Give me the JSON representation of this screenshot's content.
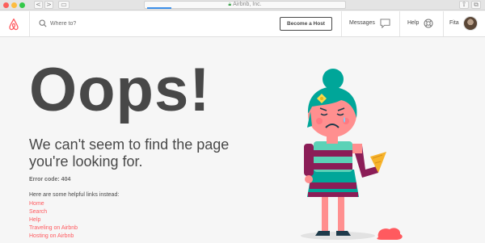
{
  "browser": {
    "url_title": "Airbnb, Inc.",
    "back": "<",
    "forward": ">"
  },
  "nav": {
    "search_placeholder": "Where to?",
    "become_host": "Become a Host",
    "messages": "Messages",
    "help": "Help",
    "user_name": "Fita"
  },
  "main": {
    "headline": "Oops!",
    "lead": "We can't seem to find the page you're looking for.",
    "error_code": "Error code: 404",
    "helpful_intro": "Here are some helpful links instead:",
    "links": [
      "Home",
      "Search",
      "Help",
      "Traveling on Airbnb",
      "Hosting on Airbnb"
    ]
  },
  "colors": {
    "brand": "#ff5a5f",
    "text": "#484848",
    "background": "#f6f6f6"
  },
  "icons": {
    "logo": "airbnb-belo-logo",
    "search": "search-icon",
    "messages": "chat-bubble-icon",
    "help": "lifebuoy-icon"
  }
}
